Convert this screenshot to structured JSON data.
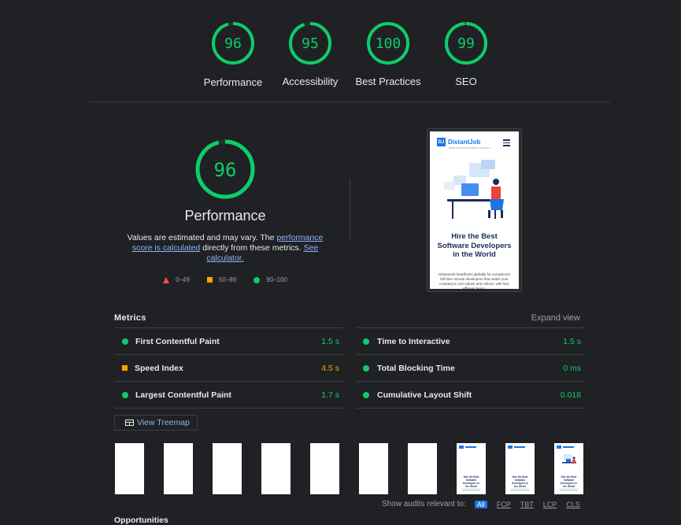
{
  "gauges": [
    {
      "score": "96",
      "label": "Performance",
      "value": 0.96,
      "color": "#0cce6b"
    },
    {
      "score": "95",
      "label": "Accessibility",
      "value": 0.95,
      "color": "#0cce6b"
    },
    {
      "score": "100",
      "label": "Best Practices",
      "value": 1.0,
      "color": "#0cce6b"
    },
    {
      "score": "99",
      "label": "SEO",
      "value": 0.99,
      "color": "#0cce6b"
    }
  ],
  "performance": {
    "score": "96",
    "value": 0.96,
    "title": "Performance",
    "desc_prefix": "Values are estimated and may vary. The ",
    "desc_link1": "performance score is calculated",
    "desc_middle": " directly from these metrics. ",
    "desc_link2": "See calculator.",
    "legend": {
      "fail": "0–49",
      "average": "50–89",
      "pass": "90–100"
    }
  },
  "screenshot": {
    "logo_badge": "DJ",
    "logo_name": "DistantJob",
    "logo_sub": "REMOTE RECRUITMENT AGENCY",
    "headline": "Hire the Best Software Developers in the World",
    "body": "DistantJob headhunts globally for exceptional full-time remote developers that match your company's core values and culture, with fast, efficient hiring."
  },
  "metrics": {
    "label": "Metrics",
    "expand_label": "Expand view",
    "left": [
      {
        "name": "First Contentful Paint",
        "value": "1.5 s",
        "status": "good"
      },
      {
        "name": "Speed Index",
        "value": "4.5 s",
        "status": "average"
      },
      {
        "name": "Largest Contentful Paint",
        "value": "1.7 s",
        "status": "good"
      }
    ],
    "right": [
      {
        "name": "Time to Interactive",
        "value": "1.5 s",
        "status": "good"
      },
      {
        "name": "Total Blocking Time",
        "value": "0 ms",
        "status": "good"
      },
      {
        "name": "Cumulative Layout Shift",
        "value": "0.018",
        "status": "good"
      }
    ]
  },
  "treemap_label": "View Treemap",
  "filmstrip": {
    "frame_headline": "Hire the Best Software Developers in the World",
    "frames": [
      "blank",
      "blank",
      "blank",
      "blank",
      "blank",
      "blank",
      "blank",
      "text",
      "text",
      "full"
    ]
  },
  "audits": {
    "label": "Show audits relevant to:",
    "chips": [
      "All",
      "FCP",
      "TBT",
      "LCP",
      "CLS"
    ]
  },
  "opportunities_label": "Opportunities",
  "colors": {
    "good": "#0cce6b",
    "average": "#ffa400",
    "fail": "#ff4e42",
    "link": "#8ab4f8",
    "accent": "#1a73e8"
  }
}
